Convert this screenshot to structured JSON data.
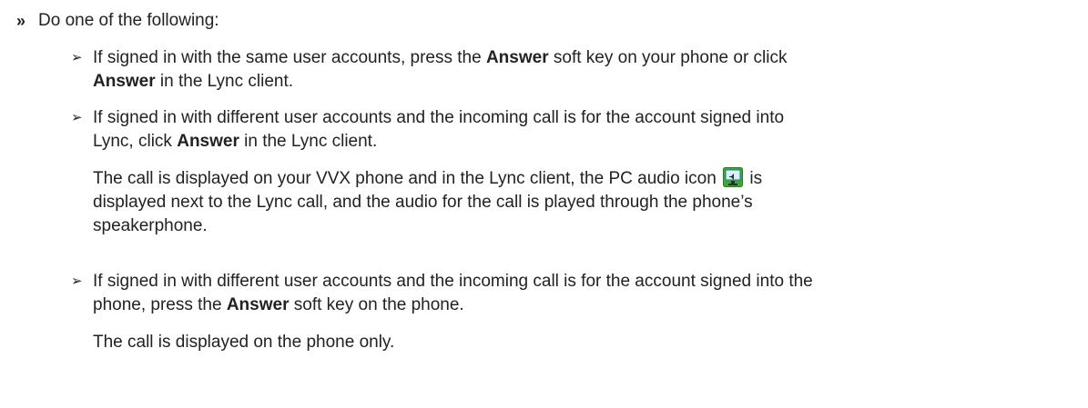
{
  "step": {
    "marker": "»",
    "text": "Do one of the following:"
  },
  "items": [
    {
      "marker": "➢",
      "part1": "If signed in with the same user accounts, press the ",
      "bold1": "Answer",
      "part2": " soft key on your phone or click",
      "bold2": "Answer",
      "part3": " in the Lync client."
    },
    {
      "marker": "➢",
      "line1": "If signed in with different user accounts and the incoming call is for the account signed into",
      "part2": "Lync, click ",
      "bold": "Answer",
      "part3": " in the Lync client."
    },
    {
      "marker": "➢",
      "line1": "If signed in with different user accounts and the incoming call is for the account signed into the",
      "part2": "phone, press the ",
      "bold": "Answer",
      "part3": " soft key on the phone."
    }
  ],
  "result1": {
    "before_icon": "The call is displayed on your VVX phone and in the Lync client, the PC audio icon",
    "after_icon": " is",
    "line2": "displayed next to the Lync call, and the audio for the call is played through the phone’s",
    "line3": "speakerphone.",
    "icon": "pc-audio-icon"
  },
  "result2": {
    "text": "The call is displayed on the phone only."
  }
}
